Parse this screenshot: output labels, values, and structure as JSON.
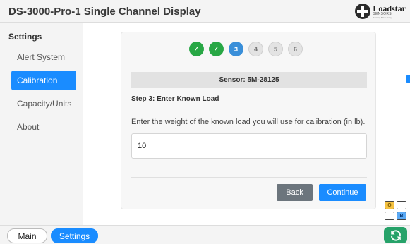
{
  "header": {
    "title": "DS-3000-Pro-1 Single Channel Display"
  },
  "logo": {
    "name": "Loadstar",
    "sub": "SENSORS",
    "tagline": "Sensing Made Easy"
  },
  "sidebar": {
    "title": "Settings",
    "items": [
      {
        "label": "Alert System",
        "active": false
      },
      {
        "label": "Calibration",
        "active": true
      },
      {
        "label": "Capacity/Units",
        "active": false
      },
      {
        "label": "About",
        "active": false
      }
    ]
  },
  "wizard": {
    "steps": [
      {
        "label": "✓",
        "state": "done"
      },
      {
        "label": "✓",
        "state": "done"
      },
      {
        "label": "3",
        "state": "current"
      },
      {
        "label": "4",
        "state": "pending"
      },
      {
        "label": "5",
        "state": "pending"
      },
      {
        "label": "6",
        "state": "pending"
      }
    ],
    "sensor": "Sensor: 5M-28125",
    "step_title": "Step 3: Enter Known Load",
    "instruction": "Enter the weight of the known load you will use for calibration (in lb).",
    "load_value": "10",
    "back_label": "Back",
    "continue_label": "Continue"
  },
  "mini_grid": {
    "a": "O",
    "b": "",
    "c": "",
    "d": "B"
  },
  "footer": {
    "main_label": "Main",
    "settings_label": "Settings"
  },
  "colors": {
    "accent": "#1a8cff",
    "done": "#28a745",
    "current": "#3a8fd9",
    "refresh": "#26a269"
  }
}
